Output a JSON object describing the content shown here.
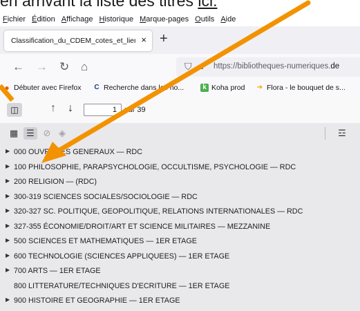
{
  "caption": {
    "text": "en arrivant la liste des titres ",
    "link": "ici."
  },
  "menubar": {
    "items": [
      "Fichier",
      "Édition",
      "Affichage",
      "Historique",
      "Marque-pages",
      "Outils",
      "Aide"
    ]
  },
  "tab": {
    "title": "Classification_du_CDEM_cotes_et_liens",
    "close": "×",
    "new_tab": "+"
  },
  "nav": {
    "url_prefix": "https://bibliotheques-numeriques.",
    "url_domain": "de"
  },
  "bookmarks": [
    {
      "label": "Débuter avec Firefox",
      "icon": "firefox-icon",
      "icon_char": "●",
      "icon_color": "#e66000"
    },
    {
      "label": "Recherche dans les no...",
      "icon": "c-logo-icon",
      "icon_char": "C",
      "icon_color": "#1a3a8a"
    },
    {
      "label": "Koha prod",
      "icon": "koha-icon",
      "icon_char": "k",
      "icon_color": "#4caf50"
    },
    {
      "label": "Flora - le bouquet de s...",
      "icon": "flora-icon",
      "icon_char": "➔",
      "icon_color": "#f4a300"
    }
  ],
  "pdf": {
    "page_number": "1",
    "page_count": "sur 39"
  },
  "outline": [
    {
      "label": "000 OUVRAGES GENERAUX — RDC",
      "expandable": true
    },
    {
      "label": "100 PHILOSOPHIE, PARAPSYCHOLOGIE, OCCULTISME, PSYCHOLOGIE — RDC",
      "expandable": true
    },
    {
      "label": "200 RELIGION — (RDC)",
      "expandable": true
    },
    {
      "label": "300-319 SCIENCES SOCIALES/SOCIOLOGIE — RDC",
      "expandable": true
    },
    {
      "label": "320-327 SC. POLITIQUE, GEOPOLITIQUE, RELATIONS INTERNATIONALES — RDC",
      "expandable": true
    },
    {
      "label": "327-355 ÉCONOMIE/DROIT/ART ET SCIENCE MILITAIRES — MEZZANINE",
      "expandable": true
    },
    {
      "label": "500 SCIENCES ET MATHEMATIQUES — 1ER ETAGE",
      "expandable": true
    },
    {
      "label": "600 TECHNOLOGIE (SCIENCES APPLIQUEES) — 1ER ETAGE",
      "expandable": true
    },
    {
      "label": "700 ARTS — 1ER ETAGE",
      "expandable": true
    },
    {
      "label": "800 LITTERATURE/TECHNIQUES D'ECRITURE — 1ER ETAGE",
      "expandable": false
    },
    {
      "label": "900 HISTOIRE ET GEOGRAPHIE — 1ER ETAGE",
      "expandable": true
    }
  ],
  "colors": {
    "arrow": "#f39200"
  }
}
